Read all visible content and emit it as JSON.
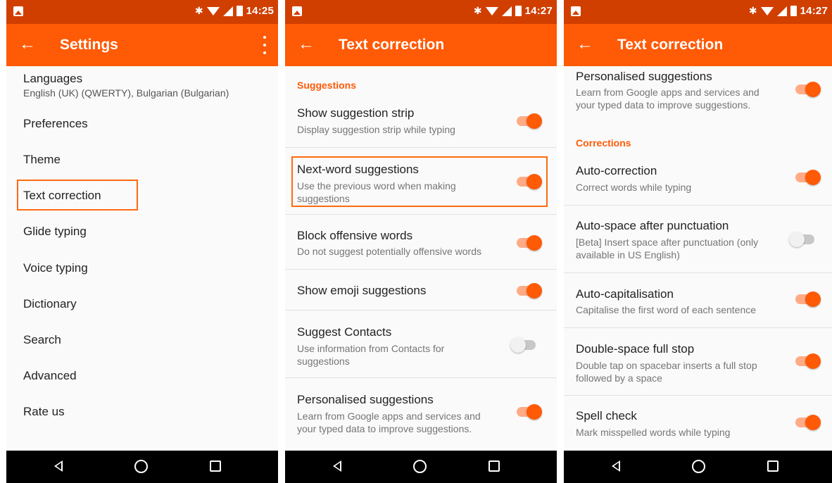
{
  "theme": {
    "accent": "#ff5a06",
    "status_bar": "#d13f00",
    "switch_track_on": "#ffab86"
  },
  "screen1": {
    "status": {
      "time": "14:25"
    },
    "appbar": {
      "title": "Settings",
      "back_icon": "arrow-left-icon",
      "menu_icon": "more-vert-icon"
    },
    "items": [
      {
        "label": "Languages",
        "sub": "English (UK) (QWERTY), Bulgarian (Bulgarian)"
      },
      {
        "label": "Preferences"
      },
      {
        "label": "Theme"
      },
      {
        "label": "Text correction",
        "highlighted": true
      },
      {
        "label": "Glide typing"
      },
      {
        "label": "Voice typing"
      },
      {
        "label": "Dictionary"
      },
      {
        "label": "Search"
      },
      {
        "label": "Advanced"
      },
      {
        "label": "Rate us"
      }
    ]
  },
  "screen2": {
    "status": {
      "time": "14:27"
    },
    "appbar": {
      "title": "Text correction"
    },
    "section": "Suggestions",
    "rows": [
      {
        "title": "Show suggestion strip",
        "sub": "Display suggestion strip while typing",
        "on": true
      },
      {
        "title": "Next-word suggestions",
        "sub": "Use the previous word when making suggestions",
        "on": true,
        "highlighted": true
      },
      {
        "title": "Block offensive words",
        "sub": "Do not suggest potentially offensive words",
        "on": true
      },
      {
        "title": "Show emoji suggestions",
        "on": true
      },
      {
        "title": "Suggest Contacts",
        "sub": "Use information from Contacts for suggestions",
        "on": false
      },
      {
        "title": "Personalised suggestions",
        "sub": "Learn from Google apps and services and your typed data to improve suggestions.",
        "on": true
      }
    ]
  },
  "screen3": {
    "status": {
      "time": "14:27"
    },
    "appbar": {
      "title": "Text correction"
    },
    "top_row": {
      "title": "Personalised suggestions",
      "sub": "Learn from Google apps and services and your typed data to improve suggestions.",
      "on": true
    },
    "section": "Corrections",
    "rows": [
      {
        "title": "Auto-correction",
        "sub": "Correct words while typing",
        "on": true
      },
      {
        "title": "Auto-space after punctuation",
        "sub": "[Beta] Insert space after punctuation (only available in US English)",
        "on": false
      },
      {
        "title": "Auto-capitalisation",
        "sub": "Capitalise the first word of each sentence",
        "on": true
      },
      {
        "title": "Double-space full stop",
        "sub": "Double tap on spacebar inserts a full stop followed by a space",
        "on": true
      },
      {
        "title": "Spell check",
        "sub": "Mark misspelled words while typing",
        "on": true
      }
    ]
  },
  "navbar": {
    "back_icon": "nav-back-icon",
    "home_icon": "nav-home-icon",
    "recents_icon": "nav-recents-icon"
  }
}
